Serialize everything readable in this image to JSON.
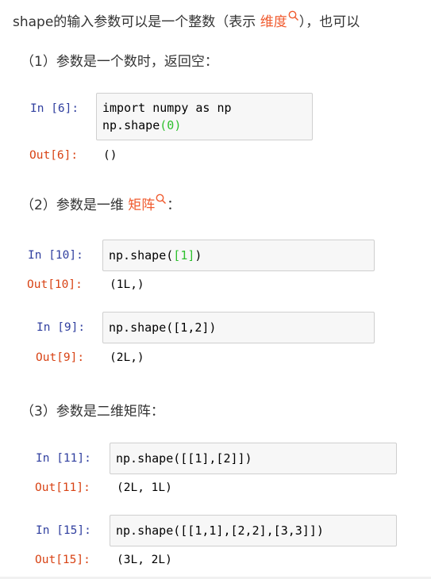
{
  "intro": {
    "prefix": "shape的输入参数可以是一个整数（表示 ",
    "link": "维度",
    "suffix": "），也可以"
  },
  "sections": {
    "s1": "（1）参数是一个数时，返回空：",
    "s2_prefix": "（2）参数是一维 ",
    "s2_link": "矩阵",
    "s2_suffix": "：",
    "s3": "（3）参数是二维矩阵："
  },
  "cells": [
    {
      "in": "In [6]:",
      "code_line1": "import numpy as np",
      "code_line2_a": "np.shape",
      "code_line2_b": "(",
      "code_line2_c": "0",
      "code_line2_d": ")",
      "out": "Out[6]:",
      "result": "()"
    },
    {
      "in": "In [10]:",
      "code_a": "np.shape(",
      "code_b": "[",
      "code_c": "1",
      "code_d": "]",
      "code_e": ")",
      "out": "Out[10]:",
      "result": "(1L,)"
    },
    {
      "in": "In [9]:",
      "code": "np.shape([1,2])",
      "out": "Out[9]:",
      "result": "(2L,)"
    },
    {
      "in": "In [11]:",
      "code": "np.shape([[1],[2]])",
      "out": "Out[11]:",
      "result": "(2L, 1L)"
    },
    {
      "in": "In [15]:",
      "code": "np.shape([[1,1],[2,2],[3,3]])",
      "out": "Out[15]:",
      "result": "(3L, 2L)"
    }
  ],
  "icons": {
    "search": "search-icon"
  },
  "colors": {
    "link": "#f05a2e",
    "prompt_in": "#303f9f",
    "prompt_out": "#d84315",
    "bracket": "#2ec02e"
  }
}
